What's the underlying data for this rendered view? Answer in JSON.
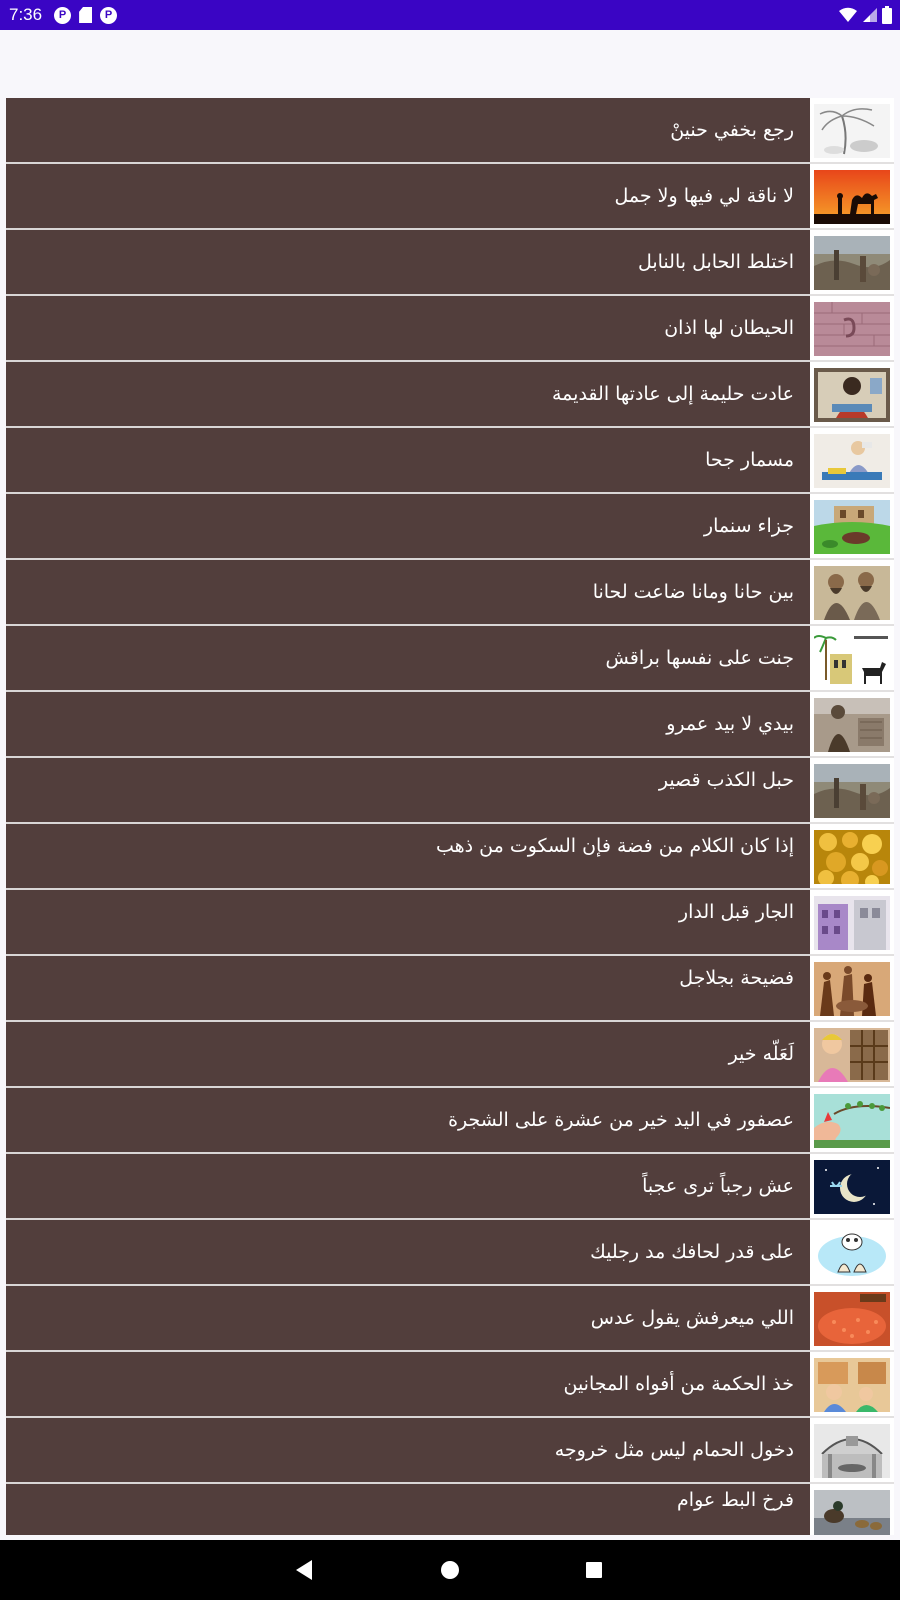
{
  "status": {
    "time": "7:36"
  },
  "colors": {
    "status_bar": "#3a05c4",
    "row_background": "#523e3c",
    "row_text": "#ffffff",
    "nav_bar": "#000000"
  },
  "items": [
    {
      "label": "رجع بخفي حنينْ",
      "thumb": "tree-sketch"
    },
    {
      "label": "لا ناقة لي فيها ولا جمل",
      "thumb": "camel-sunset"
    },
    {
      "label": "اختلط الحابل بالنابل",
      "thumb": "crowd-scene"
    },
    {
      "label": "الحيطان لها اذان",
      "thumb": "ear-on-wall"
    },
    {
      "label": "عادت حليمة إلى عادتها القديمة",
      "thumb": "woman-cooking"
    },
    {
      "label": "مسمار جحا",
      "thumb": "juha-sitting"
    },
    {
      "label": "جزاء سنمار",
      "thumb": "palace-landscape"
    },
    {
      "label": "بين حانا ومانا ضاعت لحانا",
      "thumb": "two-bearded-men"
    },
    {
      "label": "جنت على نفسها  براقش",
      "thumb": "dog-and-tower"
    },
    {
      "label": "بيدي لا بيد عمرو",
      "thumb": "warrior-scene"
    },
    {
      "label": "حبل الكذب قصير",
      "thumb": "crowd-scene"
    },
    {
      "label": "إذا كان الكلام من فضة فإن السكوت من ذهب",
      "thumb": "gold-nuggets"
    },
    {
      "label": "الجار قبل الدار",
      "thumb": "houses"
    },
    {
      "label": "فضيحة بجلاجل",
      "thumb": "procession"
    },
    {
      "label": "لَعَلّه خير",
      "thumb": "cartoon-man-window"
    },
    {
      "label": "عصفور في اليد خير من عشرة على الشجرة",
      "thumb": "bird-in-hand"
    },
    {
      "label": "عش رجباً ترى عجباً",
      "thumb": "crescent-moon"
    },
    {
      "label": "على قدر لحافك مد رجليك",
      "thumb": "feet-under-blanket"
    },
    {
      "label": "اللي ميعرفش يقول عدس",
      "thumb": "lentils"
    },
    {
      "label": "خذ الحكمة من أفواه المجانين",
      "thumb": "cartoon-market"
    },
    {
      "label": "دخول الحمام ليس مثل خروجه",
      "thumb": "bathhouse"
    },
    {
      "label": "فرخ البط عوام",
      "thumb": "ducks"
    }
  ]
}
